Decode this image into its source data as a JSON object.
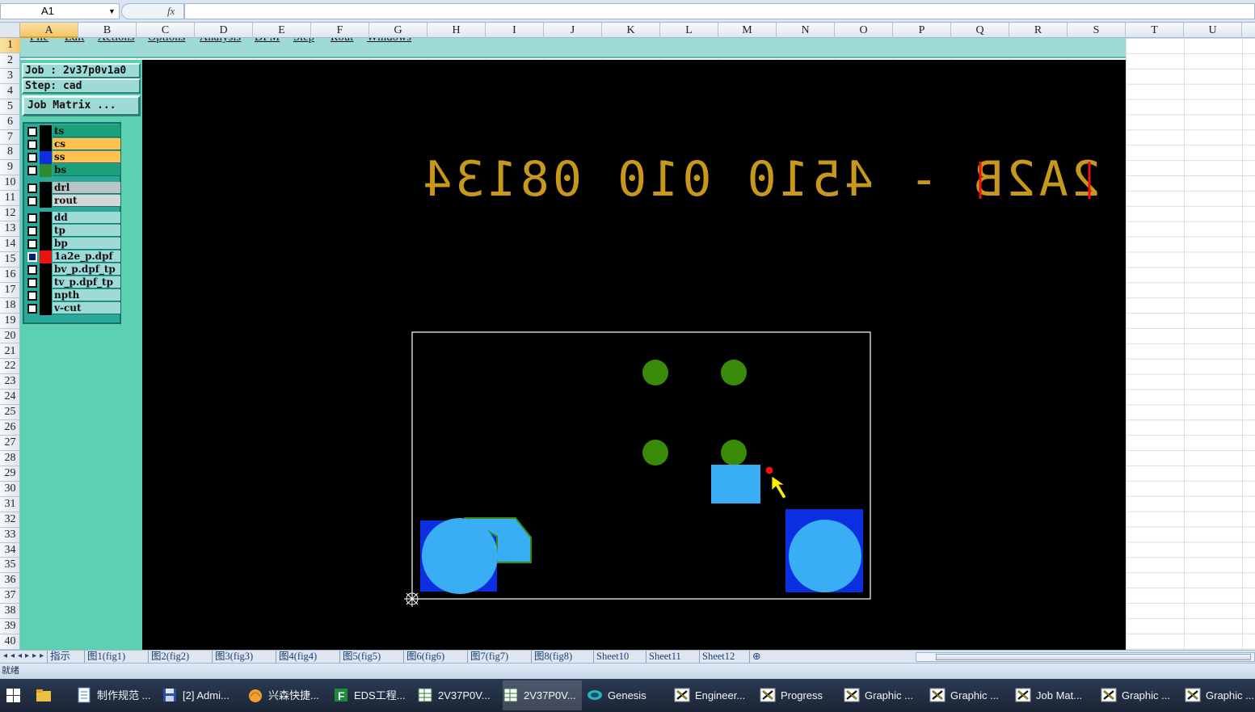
{
  "formula_bar": {
    "name_box": "A1",
    "fx_label": "fx",
    "formula": ""
  },
  "columns": [
    "A",
    "B",
    "C",
    "D",
    "E",
    "F",
    "G",
    "H",
    "I",
    "J",
    "K",
    "L",
    "M",
    "N",
    "O",
    "P",
    "Q",
    "R",
    "S",
    "T",
    "U"
  ],
  "active_column": "A",
  "rows": [
    "1",
    "2",
    "3",
    "4",
    "5",
    "6",
    "7",
    "8",
    "9",
    "10",
    "11",
    "12",
    "13",
    "14",
    "15",
    "16",
    "17",
    "18",
    "19",
    "20",
    "21",
    "22",
    "23",
    "24",
    "25",
    "26",
    "27",
    "28",
    "29",
    "30",
    "31",
    "32",
    "33",
    "34",
    "35",
    "36",
    "37",
    "38",
    "39",
    "40"
  ],
  "active_row": "1",
  "app": {
    "menu": [
      "File",
      "Edit",
      "Actions",
      "Options",
      "Analysis",
      "DFM",
      "Step",
      "Rout",
      "Windows"
    ],
    "job_label": "Job : 2v37p0v1a0",
    "step_label": "Step: cad",
    "job_matrix_button": "Job Matrix ...",
    "layers": [
      {
        "name": "ts",
        "color": "#1aa07a",
        "swatch": "#000000",
        "selected": false
      },
      {
        "name": "cs",
        "color": "#ffc04d",
        "swatch": "#000000",
        "selected": false
      },
      {
        "name": "ss",
        "color": "#ffc04d",
        "swatch": "#0a2ee0",
        "selected": false
      },
      {
        "name": "bs",
        "color": "#1aa07a",
        "swatch": "#2d8a2d",
        "selected": false
      },
      {
        "name": "drl",
        "color": "#b9c4c4",
        "swatch": "#000000",
        "selected": false
      },
      {
        "name": "rout",
        "color": "#d6d6d6",
        "swatch": "#000000",
        "selected": false
      },
      {
        "name": "dd",
        "color": "#9edbd6",
        "swatch": "#000000",
        "selected": false
      },
      {
        "name": "tp",
        "color": "#9edbd6",
        "swatch": "#000000",
        "selected": false
      },
      {
        "name": "bp",
        "color": "#9edbd6",
        "swatch": "#000000",
        "selected": false
      },
      {
        "name": "1a2e_p.dpf",
        "color": "#9edbd6",
        "swatch": "#ee1111",
        "selected": true
      },
      {
        "name": "bv_p.dpf_tp",
        "color": "#9edbd6",
        "swatch": "#000000",
        "selected": false
      },
      {
        "name": "tv_p.dpf_tp",
        "color": "#9edbd6",
        "swatch": "#000000",
        "selected": false
      },
      {
        "name": "npth",
        "color": "#9edbd6",
        "swatch": "#000000",
        "selected": false
      },
      {
        "name": "v-cut",
        "color": "#9edbd6",
        "swatch": "#000000",
        "selected": false
      }
    ],
    "canvas": {
      "mirrored_text": "2A2B - 4510 010 08134",
      "text_color": "#c8981c",
      "pad_color": "#3aaef5",
      "via_color": "#3a8a0a",
      "mask_color": "#0a2ee0",
      "marker_color": "#ee1111",
      "cursor_color": "#ffee00"
    }
  },
  "sheet_tabs": [
    "指示",
    "图1(fig1)",
    "图2(fig2)",
    "图3(fig3)",
    "图4(fig4)",
    "图5(fig5)",
    "图6(fig6)",
    "图7(fig7)",
    "图8(fig8)",
    "Sheet10",
    "Sheet11",
    "Sheet12"
  ],
  "status": "就绪",
  "taskbar": {
    "items": [
      {
        "label": "制作规范 ...",
        "icon": "document-icon"
      },
      {
        "label": "[2] Admi...",
        "icon": "floppy-icon"
      },
      {
        "label": "兴森快捷...",
        "icon": "shell-icon"
      },
      {
        "label": "EDS工程...",
        "icon": "f-app-icon"
      },
      {
        "label": "2V37P0V...",
        "icon": "spreadsheet-icon"
      },
      {
        "label": "2V37P0V...",
        "icon": "spreadsheet-icon"
      },
      {
        "label": "Genesis",
        "icon": "genesis-icon"
      },
      {
        "label": "Engineer...",
        "icon": "x-window-icon"
      },
      {
        "label": "Progress",
        "icon": "x-window-icon"
      },
      {
        "label": "Graphic ...",
        "icon": "x-window-icon"
      },
      {
        "label": "Graphic ...",
        "icon": "x-window-icon"
      },
      {
        "label": "Job Mat...",
        "icon": "x-window-icon"
      },
      {
        "label": "Graphic ...",
        "icon": "x-window-icon"
      },
      {
        "label": "Graphic ...",
        "icon": "x-window-icon"
      }
    ]
  }
}
